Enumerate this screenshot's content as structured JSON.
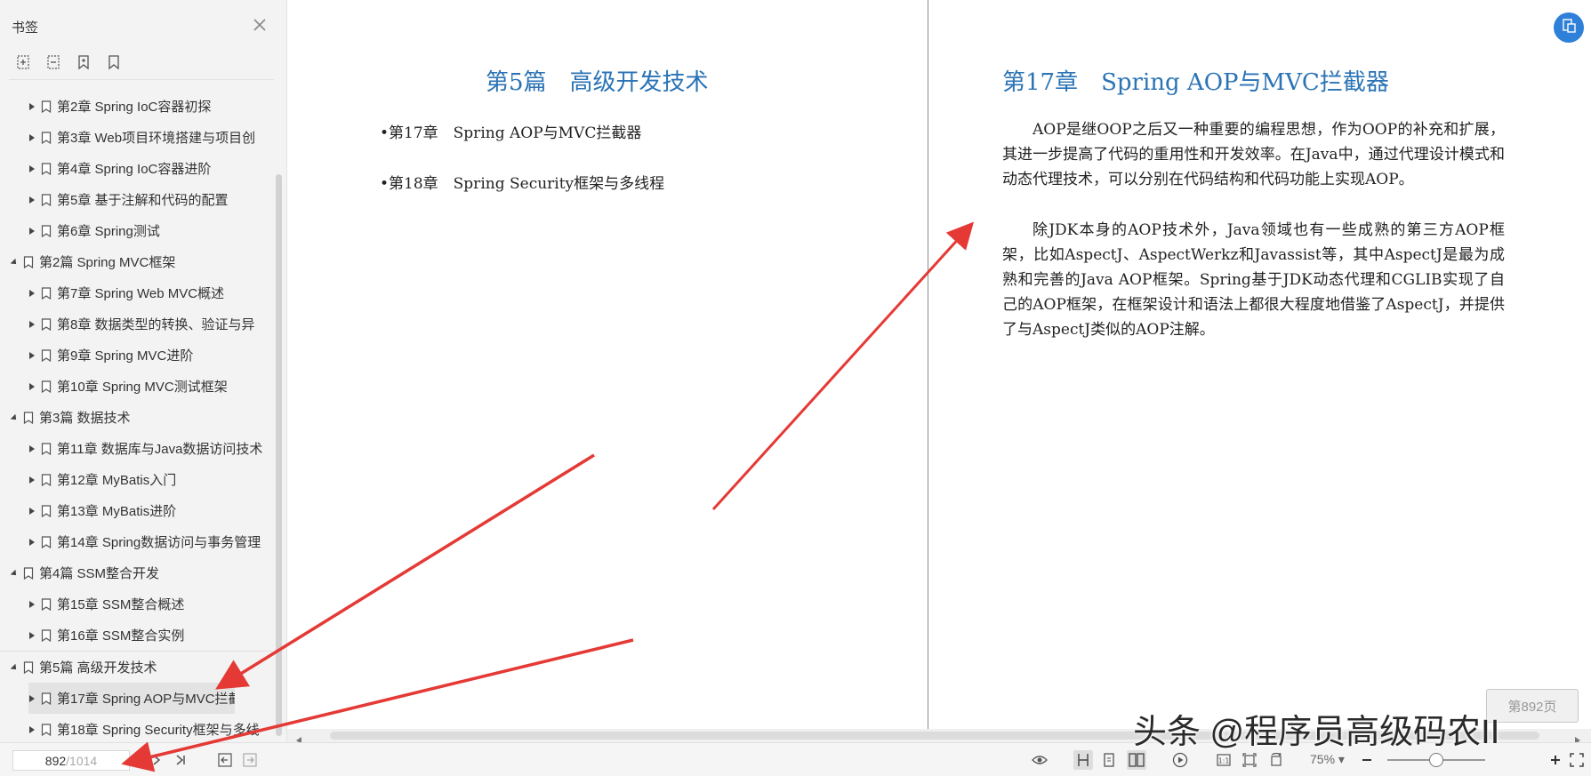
{
  "sidebar": {
    "title": "书签",
    "items": [
      {
        "level": 1,
        "label": "第2章 Spring IoC容器初探",
        "expanded": false
      },
      {
        "level": 1,
        "label": "第3章 Web项目环境搭建与项目创",
        "expanded": false
      },
      {
        "level": 1,
        "label": "第4章 Spring IoC容器进阶",
        "expanded": false
      },
      {
        "level": 1,
        "label": "第5章 基于注解和代码的配置",
        "expanded": false
      },
      {
        "level": 1,
        "label": "第6章 Spring测试",
        "expanded": false
      },
      {
        "level": 0,
        "label": "第2篇 Spring MVC框架",
        "expanded": true
      },
      {
        "level": 1,
        "label": "第7章 Spring Web MVC概述",
        "expanded": false
      },
      {
        "level": 1,
        "label": "第8章 数据类型的转换、验证与异",
        "expanded": false
      },
      {
        "level": 1,
        "label": "第9章 Spring MVC进阶",
        "expanded": false
      },
      {
        "level": 1,
        "label": "第10章 Spring MVC测试框架",
        "expanded": false
      },
      {
        "level": 0,
        "label": "第3篇 数据技术",
        "expanded": true
      },
      {
        "level": 1,
        "label": "第11章 数据库与Java数据访问技术",
        "expanded": false
      },
      {
        "level": 1,
        "label": "第12章 MyBatis入门",
        "expanded": false
      },
      {
        "level": 1,
        "label": "第13章 MyBatis进阶",
        "expanded": false
      },
      {
        "level": 1,
        "label": "第14章 Spring数据访问与事务管理",
        "expanded": false
      },
      {
        "level": 0,
        "label": "第4篇 SSM整合开发",
        "expanded": true
      },
      {
        "level": 1,
        "label": "第15章 SSM整合概述",
        "expanded": false
      },
      {
        "level": 1,
        "label": "第16章 SSM整合实例",
        "expanded": false
      },
      {
        "level": 0,
        "label": "第5篇 高级开发技术",
        "expanded": true
      },
      {
        "level": 1,
        "label": "第17章 Spring AOP与MVC拦截器",
        "expanded": false,
        "selected": true
      },
      {
        "level": 1,
        "label": "第18章 Spring Security框架与多线",
        "expanded": false
      }
    ]
  },
  "document": {
    "left_page": {
      "part_title": "第5篇　高级开发技术",
      "toc": [
        "•第17章　Spring AOP与MVC拦截器",
        "•第18章　Spring Security框架与多线程"
      ]
    },
    "right_page": {
      "chapter_title": "第17章　Spring AOP与MVC拦截器",
      "paragraphs": [
        "AOP是继OOP之后又一种重要的编程思想，作为OOP的补充和扩展，其进一步提高了代码的重用性和开发效率。在Java中，通过代理设计模式和动态代理技术，可以分别在代码结构和代码功能上实现AOP。",
        "除JDK本身的AOP技术外，Java领域也有一些成熟的第三方AOP框架，比如AspectJ、AspectWerkz和Javassist等，其中AspectJ是最为成熟和完善的Java AOP框架。Spring基于JDK动态代理和CGLIB实现了自己的AOP框架，在框架设计和语法上都很大程度地借鉴了AspectJ，并提供了与AspectJ类似的AOP注解。"
      ]
    },
    "page_indicator": "第892页"
  },
  "bottombar": {
    "current_page": "892",
    "separator": "/",
    "total_pages": "1014",
    "zoom": "75%",
    "zoom_level": 0.5,
    "zoom_caret": "▾"
  },
  "watermark": "头条 @程序员高级码农II",
  "colors": {
    "heading": "#2a73b5",
    "arrow": "#e53935",
    "sidebar_bg": "#f3f3f3",
    "fab": "#2f80d8"
  },
  "icons": [
    "close-icon",
    "expand-all-icon",
    "collapse-all-icon",
    "add-bookmark-icon",
    "bookmark-icon",
    "eye-icon",
    "play-icon",
    "zoom-in-icon",
    "fullscreen-icon"
  ]
}
